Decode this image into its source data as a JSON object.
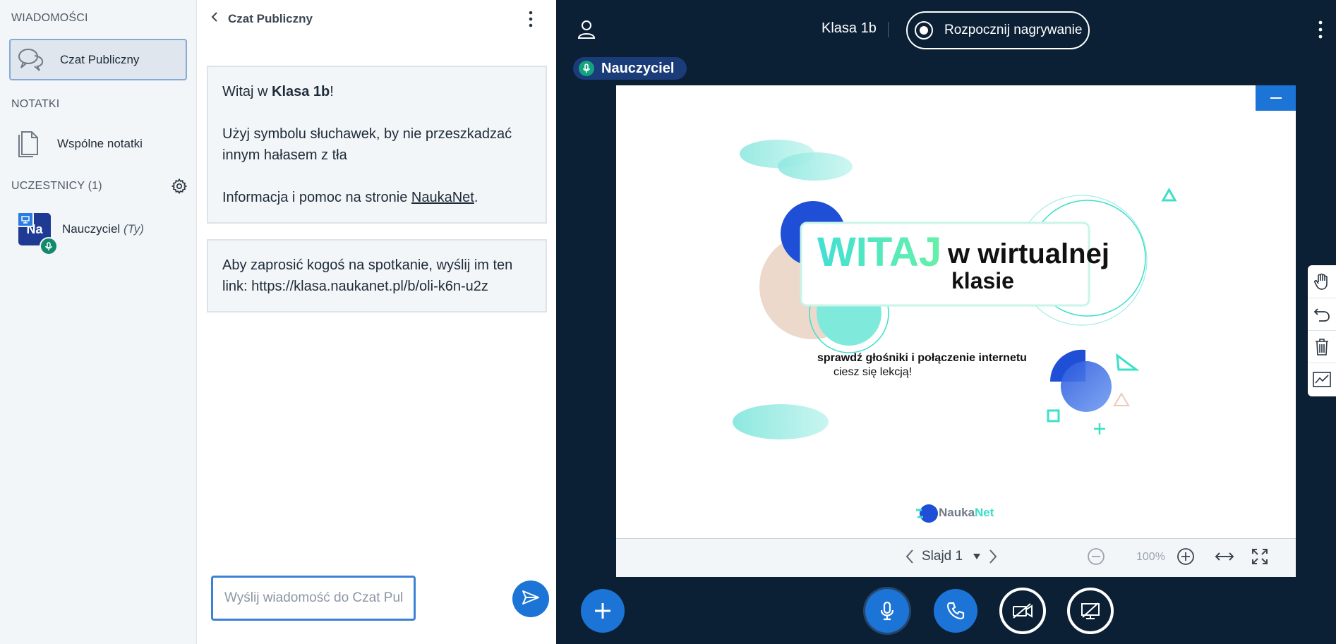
{
  "sidebar": {
    "messages_title": "WIADOMOŚCI",
    "public_chat_label": "Czat Publiczny",
    "notes_title": "NOTATKI",
    "shared_notes_label": "Wspólne notatki",
    "participants_title": "UCZESTNICY (1)",
    "participant": {
      "initials": "Na",
      "name": "Nauczyciel",
      "you_suffix": "(Ty)"
    }
  },
  "chat": {
    "header_title": "Czat Publiczny",
    "welcome": {
      "greeting_prefix": "Witaj w ",
      "room_name": "Klasa 1b",
      "greeting_suffix": "!",
      "line2": "Użyj symbolu słuchawek, by nie przeszkadzać innym hałasem z tła",
      "line3_prefix": "Informacja i pomoc na stronie ",
      "line3_link": "NaukaNet",
      "line3_suffix": "."
    },
    "invite": "Aby zaprosić kogoś na spotkanie, wyślij im ten link: https://klasa.naukanet.pl/b/oli-k6n-u2z",
    "input_placeholder": "Wyślij wiadomość do Czat Publiczny"
  },
  "main": {
    "meeting_title": "Klasa 1b",
    "record_label": "Rozpocznij nagrywanie",
    "talker_name": "Nauczyciel",
    "slide": {
      "witaj": "WITAJ",
      "w_wirtualnej": "w wirtualnej",
      "klasie": "klasie",
      "sub1": "sprawdź głośniki i połączenie internetu",
      "sub2": "ciesz się lekcją!",
      "logo_a": "Nauka",
      "logo_b": "Net"
    },
    "controls": {
      "slide_label": "Slajd 1",
      "zoom": "100%"
    }
  },
  "colors": {
    "accent": "#1b74d6",
    "dark_bg": "#0c2035",
    "teal": "#3ce0c8",
    "talker_badge": "#1a3c79"
  }
}
